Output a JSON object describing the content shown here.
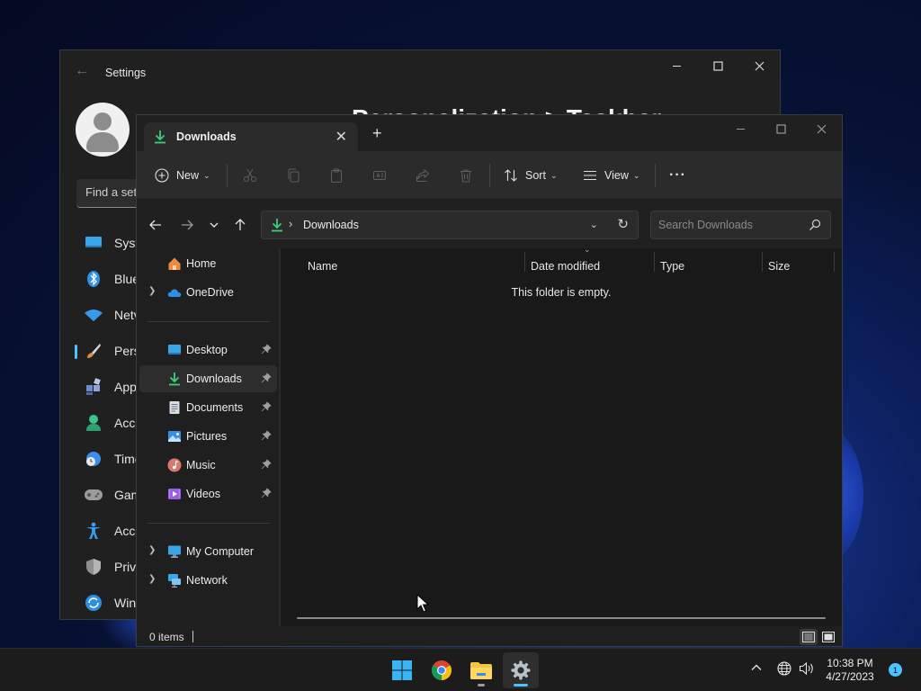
{
  "settings": {
    "title": "Settings",
    "heading": "Personalization  >  Taskbar",
    "search_value": "Find a set",
    "nav_items": [
      {
        "label": "Syst"
      },
      {
        "label": "Blue"
      },
      {
        "label": "Netv"
      },
      {
        "label": "Pers"
      },
      {
        "label": "App"
      },
      {
        "label": "Acco"
      },
      {
        "label": "Time"
      },
      {
        "label": "Gam"
      },
      {
        "label": "Acce"
      },
      {
        "label": "Priva"
      },
      {
        "label": "Win"
      }
    ]
  },
  "explorer": {
    "tab_title": "Downloads",
    "new_tab_symbol": "+",
    "toolbar": {
      "new_label": "New",
      "sort_label": "Sort",
      "view_label": "View",
      "more_label": "···"
    },
    "address": {
      "path": "Downloads",
      "search_placeholder": "Search Downloads"
    },
    "nav": {
      "home": "Home",
      "onedrive": "OneDrive",
      "quick": [
        {
          "label": "Desktop"
        },
        {
          "label": "Downloads"
        },
        {
          "label": "Documents"
        },
        {
          "label": "Pictures"
        },
        {
          "label": "Music"
        },
        {
          "label": "Videos"
        }
      ],
      "my_computer": "My Computer",
      "network": "Network"
    },
    "columns": {
      "name": "Name",
      "date": "Date modified",
      "type": "Type",
      "size": "Size"
    },
    "empty_message": "This folder is empty.",
    "status_count": "0 items"
  },
  "taskbar": {
    "time": "10:38 PM",
    "date": "4/27/2023",
    "notification_count": "1"
  },
  "colors": {
    "accent": "#4cc2ff",
    "download_green": "#3ad07a",
    "folder_yellow": "#f5c542"
  }
}
